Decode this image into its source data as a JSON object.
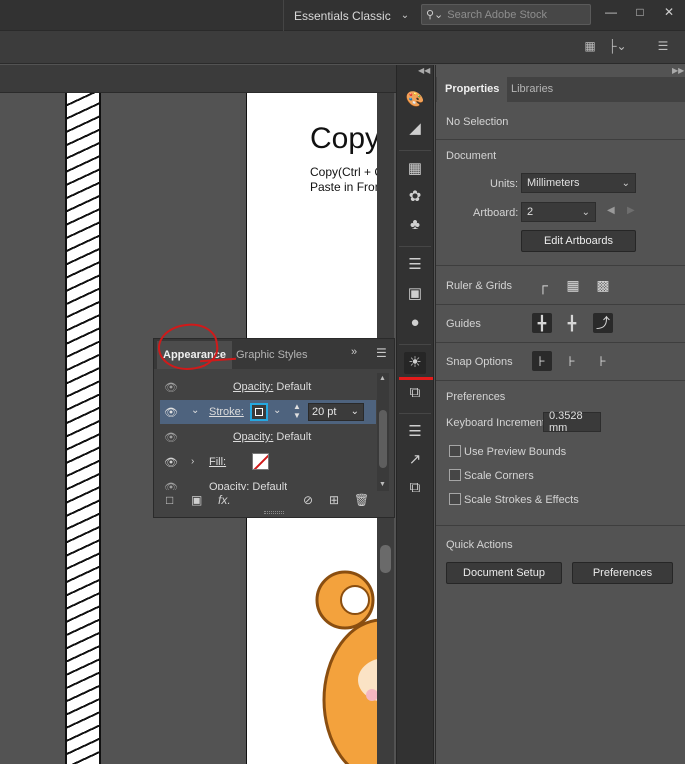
{
  "topbar": {
    "workspace": "Essentials Classic",
    "search_placeholder": "Search Adobe Stock"
  },
  "document": {
    "heading": "Copy",
    "line1": "Copy(Ctrl + C",
    "line2": "Paste in Fron"
  },
  "properties_panel": {
    "tabs": [
      "Properties",
      "Libraries"
    ],
    "no_selection": "No Selection",
    "document_title": "Document",
    "units_label": "Units:",
    "units_value": "Millimeters",
    "artboard_label": "Artboard:",
    "artboard_value": "2",
    "edit_artboards": "Edit Artboards",
    "ruler_grids": "Ruler & Grids",
    "guides": "Guides",
    "snap_options": "Snap Options",
    "preferences_title": "Preferences",
    "keyboard_increment_label": "Keyboard Increment:",
    "keyboard_increment_value": "0.3528 mm",
    "checkboxes": [
      "Use Preview Bounds",
      "Scale Corners",
      "Scale Strokes & Effects"
    ],
    "quick_actions": "Quick Actions",
    "document_setup": "Document Setup",
    "preferences_button": "Preferences"
  },
  "appearance_panel": {
    "tabs": [
      "Appearance",
      "Graphic Styles"
    ],
    "rows": {
      "opacity1": "Opacity:",
      "opacity1_value": "Default",
      "stroke_label": "Stroke:",
      "stroke_weight": "20 pt",
      "opacity2": "Opacity:",
      "opacity2_value": "Default",
      "fill_label": "Fill:",
      "opacity3": "Opacity:",
      "opacity3_value": "Default"
    },
    "fx": "fx."
  },
  "colors": {
    "accent_highlight": "#25a8e0",
    "annotation_red": "#d01a1a",
    "selected_row": "#4e637e"
  }
}
